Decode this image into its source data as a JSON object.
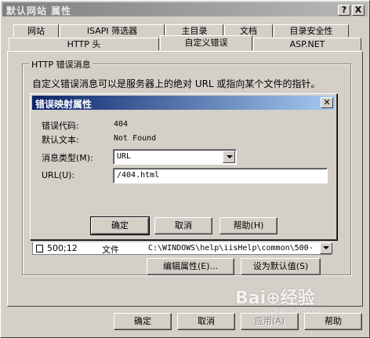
{
  "window": {
    "title": "默认网站 属性",
    "help_btn": "?",
    "close_btn": "X"
  },
  "tabs_row1": [
    {
      "label": "网站"
    },
    {
      "label": "ISAPI 筛选器"
    },
    {
      "label": "主目录"
    },
    {
      "label": "文档"
    },
    {
      "label": "目录安全性"
    }
  ],
  "tabs_row2": [
    {
      "label": "HTTP 头"
    },
    {
      "label": "自定义错误"
    },
    {
      "label": "ASP.NET"
    }
  ],
  "group": {
    "title": "HTTP 错误消息",
    "description": "自定义错误消息可以是服务器上的绝对 URL 或指向某个文件的指针。"
  },
  "list_row": {
    "code": "500;12",
    "type": "文件",
    "path": "C:\\WINDOWS\\help\\iisHelp\\common\\500-"
  },
  "panel_buttons": {
    "edit": "编辑属性(E)...",
    "default": "设为默认值(S)"
  },
  "dialog": {
    "title": "错误映射属性",
    "code_label": "错误代码:",
    "code_value": "404",
    "default_text_label": "默认文本:",
    "default_text_value": "Not Found",
    "msg_type_label": "消息类型(M):",
    "msg_type_value": "URL",
    "url_label": "URL(U):",
    "url_value": "/404.html",
    "ok": "确定",
    "cancel": "取消",
    "help": "帮助(H)"
  },
  "bottom_buttons": {
    "ok": "确定",
    "cancel": "取消",
    "apply": "应用(A)",
    "help": "帮助"
  },
  "watermark": {
    "logo": "Bai⊕经验",
    "url": "jingyan.baidu.com"
  }
}
